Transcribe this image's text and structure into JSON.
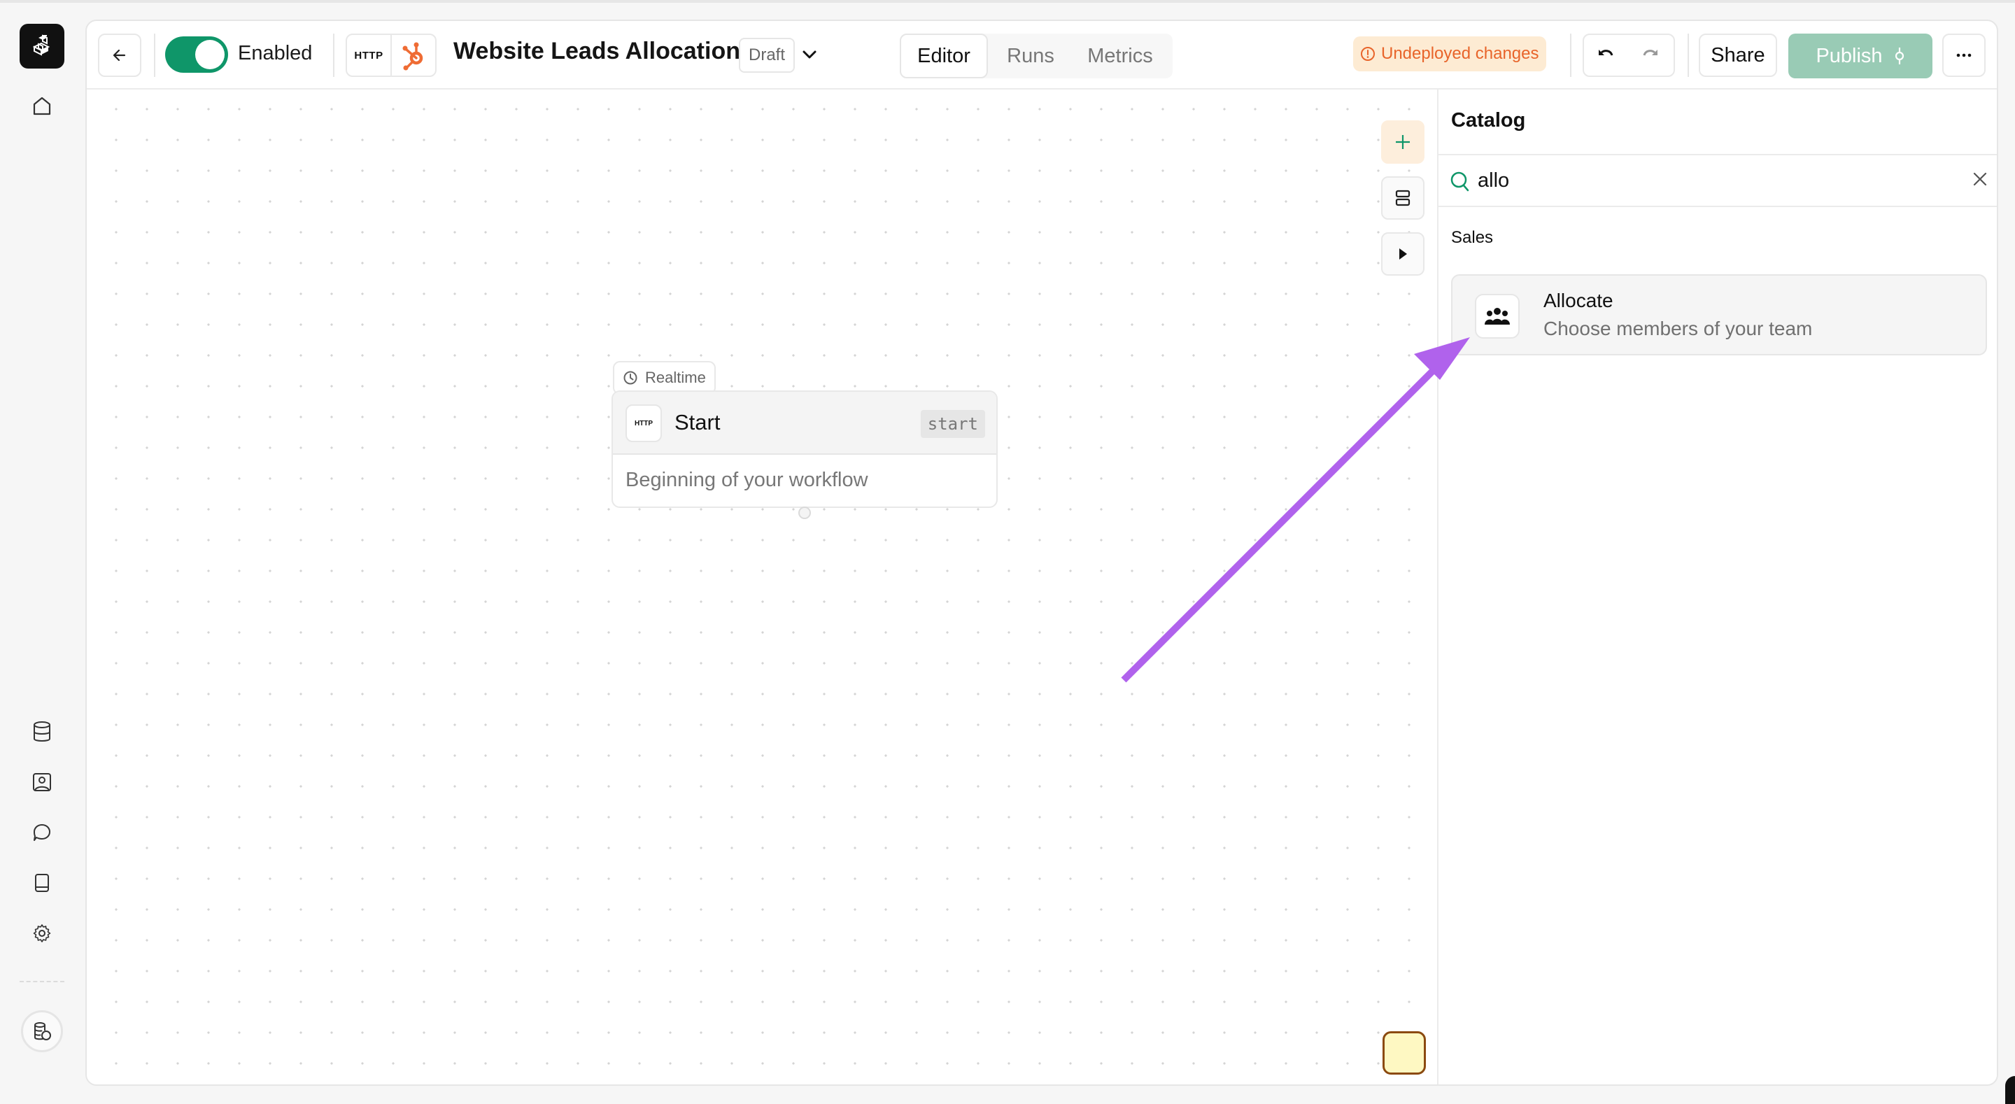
{
  "rail": {
    "logo": "app-logo-icon",
    "items": [
      {
        "name": "home",
        "icon": "home-icon"
      },
      {
        "name": "data",
        "icon": "database-icon"
      },
      {
        "name": "contacts",
        "icon": "contact-icon"
      },
      {
        "name": "messages",
        "icon": "chat-icon"
      },
      {
        "name": "docs",
        "icon": "book-icon"
      },
      {
        "name": "settings",
        "icon": "gear-icon"
      }
    ],
    "workspace": "workspace-icon"
  },
  "header": {
    "back_icon": "arrow-left-icon",
    "toggle_enabled": true,
    "toggle_label": "Enabled",
    "integration_http": "HTTP",
    "integration_hubspot": "hubspot-icon",
    "title": "Website Leads Allocation",
    "status": "Draft",
    "tabs": [
      {
        "label": "Editor",
        "active": true
      },
      {
        "label": "Runs",
        "active": false
      },
      {
        "label": "Metrics",
        "active": false
      }
    ],
    "undeployed_label": "Undeployed changes",
    "share_label": "Share",
    "publish_label": "Publish",
    "colors": {
      "toggle": "#0f9669",
      "publish": "#99cbb5",
      "warning": "#e8642a",
      "warning_bg": "#fdebd3",
      "annotation_arrow": "#b062ec"
    }
  },
  "canvas": {
    "trigger_badge": "Realtime",
    "node": {
      "icon_label": "HTTP",
      "title": "Start",
      "code": "start",
      "description": "Beginning of your workflow"
    }
  },
  "catalog": {
    "title": "Catalog",
    "search_value": "allo",
    "section": "Sales",
    "items": [
      {
        "title": "Allocate",
        "description": "Choose members of your team",
        "icon": "team-icon"
      }
    ]
  }
}
